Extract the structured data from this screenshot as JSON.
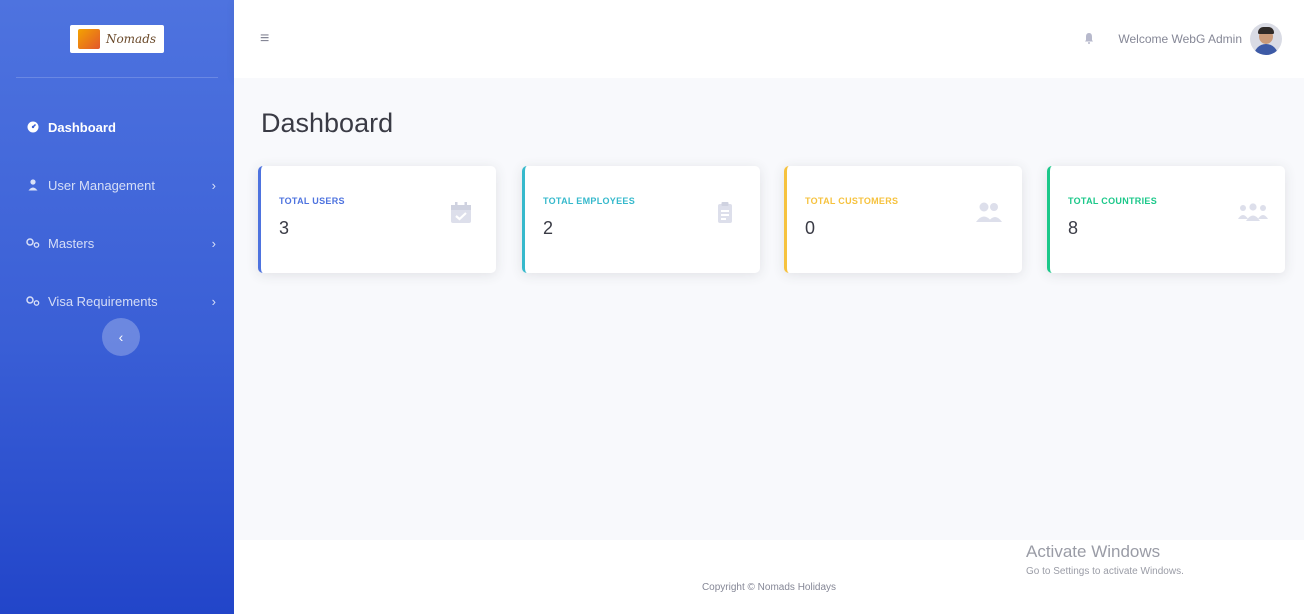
{
  "sidebar": {
    "brand": {
      "logo_text": "Nomads"
    },
    "items": [
      {
        "label": "Dashboard",
        "icon": "dashboard-icon",
        "active": true,
        "has_chevron": false
      },
      {
        "label": "User Management",
        "icon": "user-icon",
        "active": false,
        "has_chevron": true
      },
      {
        "label": "Masters",
        "icon": "cogs-icon",
        "active": false,
        "has_chevron": true
      },
      {
        "label": "Visa Requirements",
        "icon": "cogs-icon",
        "active": false,
        "has_chevron": true
      }
    ],
    "collapse_icon": "chevron-left-icon"
  },
  "topbar": {
    "menu_icon": "hamburger-icon",
    "notification_icon": "bell-icon",
    "welcome_text": "Welcome WebG Admin"
  },
  "main": {
    "title": "Dashboard",
    "cards": [
      {
        "title": "TOTAL USERS",
        "value": "3",
        "icon": "calendar-check-icon",
        "color": "#4e73df"
      },
      {
        "title": "TOTAL EMPLOYEES",
        "value": "2",
        "icon": "clipboard-icon",
        "color": "#36b9cc"
      },
      {
        "title": "TOTAL CUSTOMERS",
        "value": "0",
        "icon": "users-icon",
        "color": "#f6c23e"
      },
      {
        "title": "TOTAL COUNTRIES",
        "value": "8",
        "icon": "users-group-icon",
        "color": "#1cc88a"
      }
    ]
  },
  "footer": {
    "copyright": "Copyright © Nomads Holidays"
  },
  "overlay": {
    "activate_title": "Activate Windows",
    "activate_subtitle": "Go to Settings to activate Windows."
  }
}
